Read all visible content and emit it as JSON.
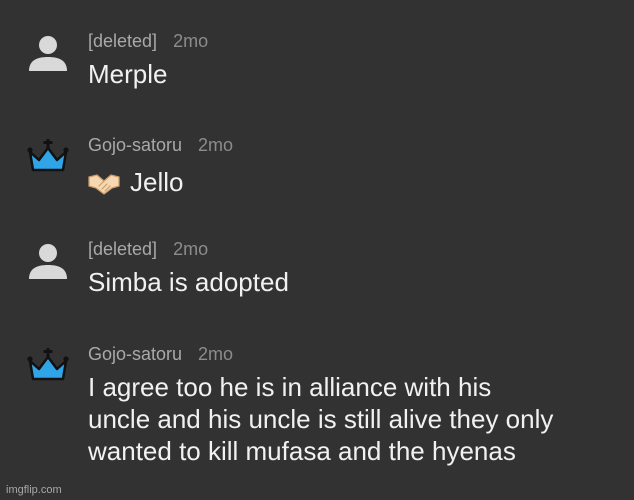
{
  "comments": [
    {
      "username": "[deleted]",
      "time": "2mo",
      "avatar_icon": "default-user-icon",
      "lines": [
        "Merple"
      ]
    },
    {
      "username": "Gojo-satoru",
      "time": "2mo",
      "avatar_icon": "crown-icon",
      "emoji_icon": "handshake-icon",
      "lines": [
        "Jello"
      ]
    },
    {
      "username": "[deleted]",
      "time": "2mo",
      "avatar_icon": "default-user-icon",
      "lines": [
        "Simba is adopted"
      ]
    },
    {
      "username": "Gojo-satoru",
      "time": "2mo",
      "avatar_icon": "crown-icon",
      "lines": [
        "I agree too he is in alliance with his",
        "uncle and his uncle is still alive they only",
        "wanted to kill mufasa and the hyenas"
      ]
    }
  ],
  "colors": {
    "background": "#323232",
    "crown": "#2fa4e7",
    "crown_outline": "#111111",
    "default_avatar": "#d9d9d9"
  },
  "watermark": "imgflip.com"
}
